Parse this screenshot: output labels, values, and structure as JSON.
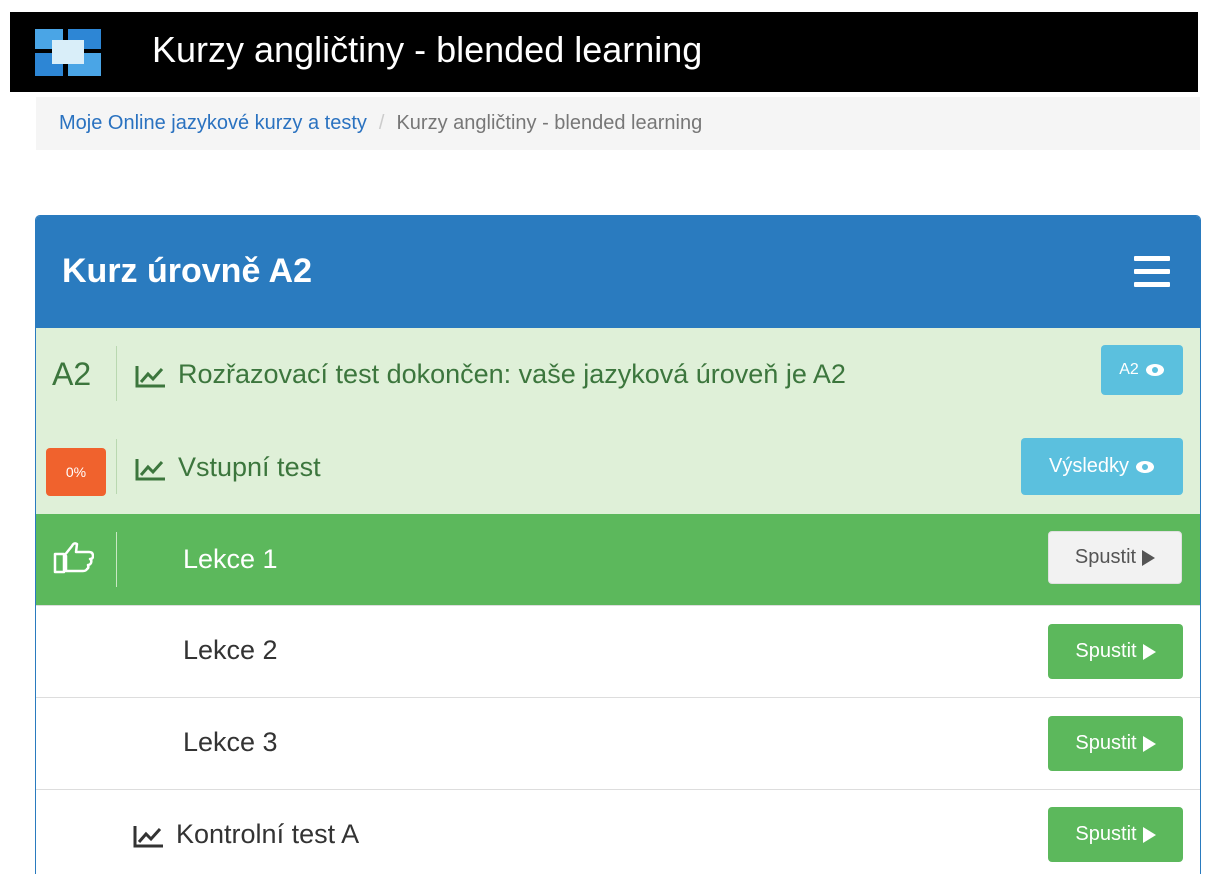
{
  "header": {
    "title": "Kurzy angličtiny - blended learning",
    "logo_icon": "app-logo-icon"
  },
  "breadcrumb": {
    "items": [
      {
        "label": "Moje Online jazykové kurzy a testy",
        "link": true
      },
      {
        "label": "Kurzy angličtiny - blended learning",
        "link": false
      }
    ],
    "separator": "/"
  },
  "panel": {
    "title": "Kurz úrovně A2",
    "rows": [
      {
        "status": "A2",
        "icon": "chart-line-icon",
        "label": "Rozřazovací test dokončen: vaše jazyková úroveň je A2",
        "button": "A2"
      },
      {
        "status": "0%",
        "icon": "chart-line-icon",
        "label": "Vstupní test",
        "button": "Výsledky"
      },
      {
        "status_icon": "hand-pointer-icon",
        "label": "Lekce 1",
        "button": "Spustit"
      },
      {
        "label": "Lekce 2",
        "button": "Spustit"
      },
      {
        "label": "Lekce 3",
        "button": "Spustit"
      },
      {
        "icon": "chart-line-icon",
        "label": "Kontrolní test A",
        "button": "Spustit"
      }
    ]
  },
  "colors": {
    "topbar": "#000000",
    "panel_header": "#2a7bbf",
    "completed_row": "#dff0d8",
    "active_row": "#5cb85c",
    "info_button": "#5bc0de",
    "success_button": "#5cb85c",
    "progress_badge": "#f0622d"
  }
}
